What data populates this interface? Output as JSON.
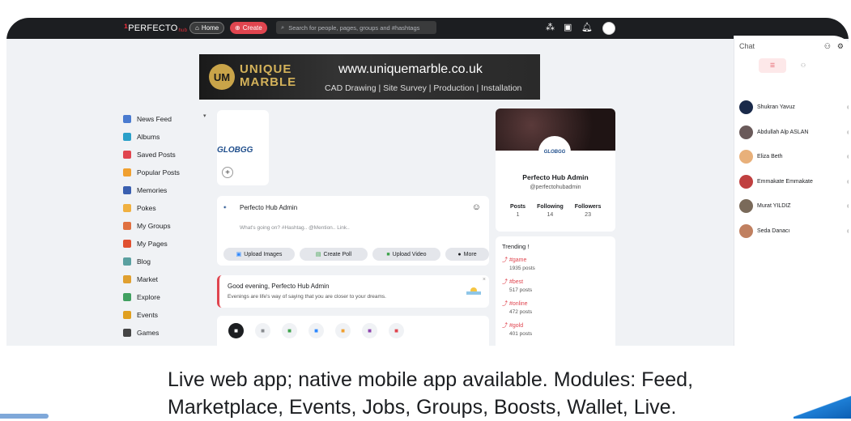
{
  "topbar": {
    "logo_text": "PERFECTO",
    "logo_hub": "hub",
    "home_label": "Home",
    "create_label": "Create",
    "search_placeholder": "Search for people, pages, groups and #hashtags"
  },
  "banner": {
    "brand_line1": "UNIQUE",
    "brand_line2": "MARBLE",
    "mark": "UM",
    "url": "www.uniquemarble.co.uk",
    "services": "CAD Drawing | Site Survey | Production | Installation"
  },
  "sidebar": {
    "items": [
      {
        "label": "News Feed",
        "icon": "home-icon",
        "color": "#4a7bd0"
      },
      {
        "label": "Albums",
        "icon": "albums-icon",
        "color": "#2aa0c9"
      },
      {
        "label": "Saved Posts",
        "icon": "bookmark-icon",
        "color": "#e0454f"
      },
      {
        "label": "Popular Posts",
        "icon": "popular-icon",
        "color": "#f0a030"
      },
      {
        "label": "Memories",
        "icon": "memories-icon",
        "color": "#3a5fb0"
      },
      {
        "label": "Pokes",
        "icon": "poke-icon",
        "color": "#f0b040"
      },
      {
        "label": "My Groups",
        "icon": "groups-icon",
        "color": "#e07040"
      },
      {
        "label": "My Pages",
        "icon": "pages-icon",
        "color": "#e05030"
      },
      {
        "label": "Blog",
        "icon": "blog-icon",
        "color": "#5aa0a0"
      },
      {
        "label": "Market",
        "icon": "market-icon",
        "color": "#e0a030"
      },
      {
        "label": "Explore",
        "icon": "explore-icon",
        "color": "#40a060"
      },
      {
        "label": "Events",
        "icon": "events-icon",
        "color": "#e0a020"
      },
      {
        "label": "Games",
        "icon": "games-icon",
        "color": "#444444"
      }
    ]
  },
  "story": {
    "logo_text": "GLOBGG"
  },
  "composer": {
    "name": "Perfecto Hub Admin",
    "placeholder": "What's going on? #Hashtag.. @Mention.. Link..",
    "buttons": [
      "Upload Images",
      "Create Poll",
      "Upload Video",
      "More"
    ]
  },
  "greeting": {
    "title": "Good evening, Perfecto Hub Admin",
    "subtitle": "Evenings are life's way of saying that you are closer to your dreams.",
    "close": "×"
  },
  "quick_actions": [
    {
      "icon": "text-post-icon",
      "color": "#1c1e21"
    },
    {
      "icon": "gif-icon",
      "color": "#8a8d91"
    },
    {
      "icon": "image-icon",
      "color": "#3fa34d"
    },
    {
      "icon": "video-icon",
      "color": "#2d88ff"
    },
    {
      "icon": "music-icon",
      "color": "#f0a030"
    },
    {
      "icon": "file-icon",
      "color": "#8e44ad"
    },
    {
      "icon": "live-icon",
      "color": "#e0454f"
    }
  ],
  "profile": {
    "name": "Perfecto Hub Admin",
    "handle": "@perfectohubadmin",
    "avatar_text": "GLOBGG",
    "stats": [
      {
        "label": "Posts",
        "value": "1"
      },
      {
        "label": "Following",
        "value": "14"
      },
      {
        "label": "Followers",
        "value": "23"
      }
    ]
  },
  "trending": {
    "title": "Trending !",
    "items": [
      {
        "tag": "#game",
        "count": "1935 posts"
      },
      {
        "tag": "#best",
        "count": "517 posts"
      },
      {
        "tag": "#online",
        "count": "472 posts"
      },
      {
        "tag": "#gold",
        "count": "401 posts"
      }
    ]
  },
  "chat": {
    "title": "Chat",
    "users": [
      {
        "name": "Shukran Yavuz",
        "color": "#1a2a4a"
      },
      {
        "name": "Abdullah Alp ASLAN",
        "color": "#6a5a5a"
      },
      {
        "name": "Eliza Beth",
        "color": "#e8b07a"
      },
      {
        "name": "Emmakate Emmakate",
        "color": "#c04040"
      },
      {
        "name": "Murat YILDIZ",
        "color": "#7a6a5a"
      },
      {
        "name": "Seda Danacı",
        "color": "#c08060"
      }
    ]
  },
  "caption": {
    "line1": "Live web app; native mobile app available. Modules: Feed,",
    "line2": "Marketplace, Events, Jobs, Groups, Boosts, Wallet, Live."
  },
  "colors": {
    "accent": "#e0454f",
    "topbar": "#1c1e21",
    "background": "#f0f2f5"
  }
}
